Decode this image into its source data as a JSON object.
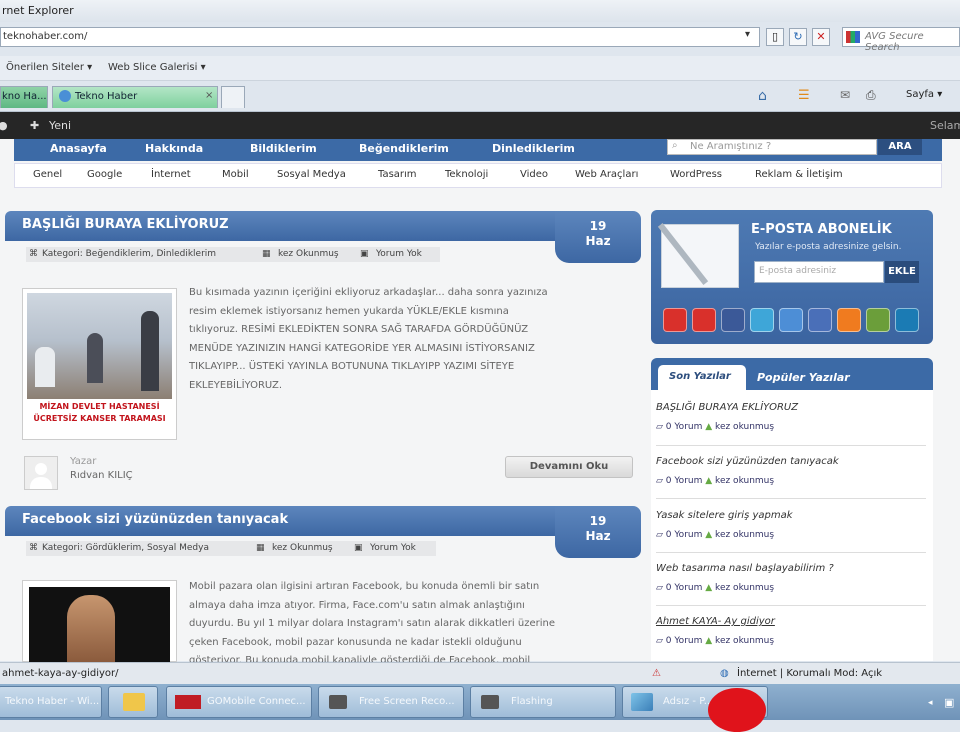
{
  "window": {
    "title": "rnet Explorer"
  },
  "address": {
    "url": "teknohaber.com/",
    "search_placeholder": "AVG Secure Search"
  },
  "favorites": {
    "suggested": "Önerilen Siteler ▾",
    "webslice": "Web Slice Galerisi ▾"
  },
  "tabs": [
    {
      "label": "kno Ha..."
    },
    {
      "label": "Tekno Haber"
    }
  ],
  "toolbar": {
    "page_label": "Sayfa ▾"
  },
  "sitebar": {
    "new_label": "Yeni",
    "right_label": "Selam"
  },
  "mainnav": [
    "Anasayfa",
    "Hakkında",
    "Bildiklerim",
    "Beğendiklerim",
    "Dinlediklerim"
  ],
  "site_search": {
    "placeholder": "Ne Aramıştınız ?",
    "button": "ARA"
  },
  "subnav": [
    "Genel",
    "Google",
    "İnternet",
    "Mobil",
    "Sosyal Medya",
    "Tasarım",
    "Teknoloji",
    "Video",
    "Web Araçları",
    "WordPress",
    "Reklam & İletişim"
  ],
  "posts": [
    {
      "title": "BAŞLIĞI BURAYA EKLİYORUZ",
      "date_day": "19",
      "date_month": "Haz",
      "category": "Kategori: Beğendiklerim, Dinlediklerim",
      "reads": "kez Okunmuş",
      "comments": "Yorum Yok",
      "thumb_caption_1": "MİZAN DEVLET HASTANESİ",
      "thumb_caption_2": "ÜCRETSİZ KANSER TARAMASI",
      "excerpt": [
        "Bu kısımada yazının içeriğini ekliyoruz arkadaşlar... daha sonra yazınıza",
        "resim eklemek istiyorsanız hemen yukarda YÜKLE/EKLE kısmına",
        "tıklıyoruz. RESİMİ EKLEDİKTEN SONRA SAĞ TARAFDA GÖRDÜĞÜNÜZ",
        "MENÜDE YAZINIZIN HANGİ KATEGORİDE YER ALMASINI İSTİYORSANIZ",
        "TIKLAYIPP... ÜSTEKİ YAYINLA BOTUNUNA TIKLAYIPP YAZIMI SİTEYE",
        "EKLEYEBİLİYORUZ."
      ],
      "author_label": "Yazar",
      "author_name": "Rıdvan KILIÇ",
      "more_button": "Devamını Oku"
    },
    {
      "title": "Facebook sizi yüzünüzden tanıyacak",
      "date_day": "19",
      "date_month": "Haz",
      "category": "Kategori: Gördüklerim, Sosyal Medya",
      "reads": "kez Okunmuş",
      "comments": "Yorum Yok",
      "excerpt": [
        "Mobil pazara olan ilgisini artıran Facebook, bu konuda önemli bir satın",
        "almaya daha imza atıyor. Firma, Face.com'u satın almak anlaştığını",
        "duyurdu. Bu yıl 1 milyar dolara Instagram'ı satın alarak dikkatleri üzerine",
        "çeken Facebook, mobil pazar konusunda ne kadar istekli olduğunu",
        "gösteriyor. Bu konuda mobil kanaliyle gösterdiği de Facebook, mobil"
      ]
    }
  ],
  "subscribe": {
    "title": "E-POSTA ABONELİK",
    "subtitle": "Yazılar e-posta adresinize gelsin.",
    "placeholder": "E-posta adresiniz",
    "button": "EKLE"
  },
  "social_icons": [
    "youtube-icon",
    "myspace-icon",
    "facebook-icon",
    "twitter-icon",
    "friendfeed-icon",
    "flickr-icon",
    "rss-icon",
    "delicious-icon",
    "linkedin-icon"
  ],
  "social_colors": [
    "#d9302b",
    "#d9302b",
    "#3b5998",
    "#3ea6d8",
    "#4d8ed6",
    "#4a6fb8",
    "#f07b1f",
    "#6b9e3a",
    "#1b7bb4"
  ],
  "sidebar_tabs": {
    "active": "Son Yazılar",
    "inactive": "Popüler Yazılar"
  },
  "recent": [
    {
      "title": "BAŞLIĞI BURAYA EKLİYORUZ",
      "comments": "0 Yorum",
      "reads": "kez okunmuş"
    },
    {
      "title": "Facebook sizi yüzünüzden tanıyacak",
      "comments": "0 Yorum",
      "reads": "kez okunmuş"
    },
    {
      "title": "Yasak sitelere giriş yapmak",
      "comments": "0 Yorum",
      "reads": "kez okunmuş"
    },
    {
      "title": "Web tasarıma nasıl başlayabilirim ?",
      "comments": "0 Yorum",
      "reads": "kez okunmuş"
    },
    {
      "title": "Ahmet KAYA- Ay gidiyor",
      "comments": "0 Yorum",
      "reads": "kez okunmuş"
    }
  ],
  "status": {
    "link": "ahmet-kaya-ay-gidiyor/",
    "zone": "İnternet | Korumalı Mod: Açık"
  },
  "taskbar": [
    {
      "label": "Tekno Haber - Wi..."
    },
    {
      "label": ""
    },
    {
      "label": "GOMobile Connec..."
    },
    {
      "label": "Free Screen Reco..."
    },
    {
      "label": "Flashing"
    },
    {
      "label": "Adsız - P..."
    }
  ]
}
